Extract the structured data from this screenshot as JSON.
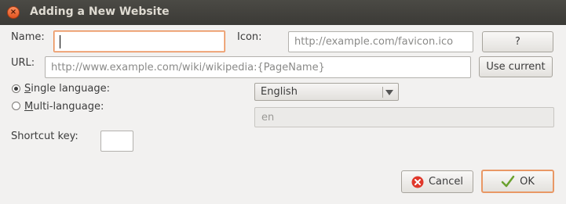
{
  "window": {
    "title": "Adding a New Website"
  },
  "form": {
    "name_label": "Name:",
    "name_value": "",
    "icon_label": "Icon:",
    "icon_placeholder": "http://example.com/favicon.ico",
    "icon_help_button": "?",
    "url_label": "URL:",
    "url_placeholder": "http://www.example.com/wiki/wikipedia:{PageName}",
    "use_current_button": "Use current",
    "language_mode": {
      "single_label_accel": "S",
      "single_label_rest": "ingle language:",
      "multi_label_accel": "M",
      "multi_label_rest": "ulti-language:",
      "selected": "single"
    },
    "language_select": {
      "value": "English"
    },
    "language_code": "en",
    "shortcut_label": "Shortcut key:",
    "shortcut_value": ""
  },
  "buttons": {
    "cancel": "Cancel",
    "ok": "OK"
  },
  "colors": {
    "cancel_icon": "#e0382b",
    "ok_check": "#6aa12e",
    "focus": "#e98b52"
  }
}
